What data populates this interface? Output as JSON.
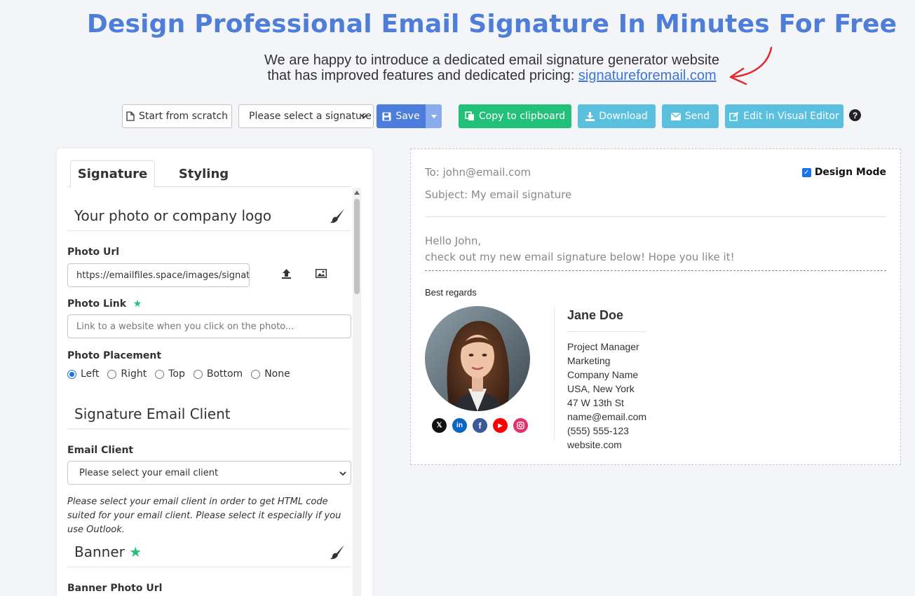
{
  "hero": {
    "title": "Design Professional Email Signature In Minutes For Free",
    "subtitle_line1": "We are happy to introduce a dedicated email signature generator website",
    "subtitle_line2_prefix": "that has improved features and dedicated pricing:",
    "subtitle_link": "signatureforemail.com"
  },
  "toolbar": {
    "start_scratch": "Start from scratch",
    "select_signature": "Please select a signature",
    "save": "Save",
    "copy": "Copy to clipboard",
    "download": "Download",
    "send": "Send",
    "visual_editor": "Edit in Visual Editor",
    "help": "?"
  },
  "tabs": {
    "signature": "Signature",
    "styling": "Styling"
  },
  "form": {
    "photo_section": "Your photo or company logo",
    "photo_url_label": "Photo Url",
    "photo_url_value": "https://emailfiles.space/images/signature-photo.jpg",
    "photo_link_label": "Photo Link",
    "photo_link_placeholder": "Link to a website when you click on the photo...",
    "placement_label": "Photo Placement",
    "placement_options": [
      "Left",
      "Right",
      "Top",
      "Bottom",
      "None"
    ],
    "placement_selected": "Left",
    "client_section": "Signature Email Client",
    "client_label": "Email Client",
    "client_select": "Please select your email client",
    "client_note": "Please select your email client in order to get HTML code suited for your email client. Please select it especially if you use Outlook.",
    "banner_section": "Banner",
    "banner_url_label": "Banner Photo Url"
  },
  "preview": {
    "to": "To: john@email.com",
    "subject": "Subject: My email signature",
    "design_mode": "Design Mode",
    "hello": "Hello John,",
    "message": "check out my new email signature below! Hope you like it!",
    "regards": "Best regards",
    "name": "Jane Doe",
    "title": "Project Manager",
    "department": "Marketing",
    "company": "Company Name",
    "location": "USA, New York",
    "street": "47 W 13th St",
    "email": "name@email.com",
    "phone": "(555) 555-123",
    "website": "website.com"
  },
  "colors": {
    "title_blue": "#4f7ed9",
    "save_blue": "#4d7ddc",
    "copy_green": "#23c07a",
    "action_cyan": "#5bc0de"
  },
  "socials": [
    "x-icon",
    "linkedin-icon",
    "facebook-icon",
    "youtube-icon",
    "instagram-icon"
  ]
}
